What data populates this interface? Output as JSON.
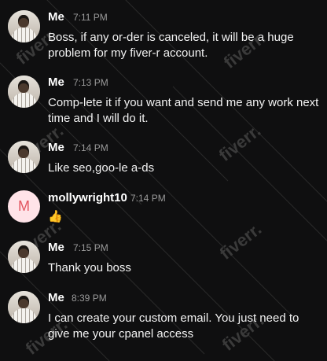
{
  "watermark_text": "fiverr.",
  "messages": [
    {
      "sender": "Me",
      "time": "7:11 PM",
      "avatar_kind": "photo",
      "text": "Boss, if any or-der is canceled, it will be a huge problem for my fiver-r account."
    },
    {
      "sender": "Me",
      "time": "7:13 PM",
      "avatar_kind": "photo",
      "text": "Comp-lete it if you want and send me any work next time and I will do it."
    },
    {
      "sender": "Me",
      "time": "7:14 PM",
      "avatar_kind": "photo",
      "text": "Like seo,goo-le a-ds"
    },
    {
      "sender": "mollywright10",
      "time": "7:14 PM",
      "avatar_kind": "letter",
      "avatar_letter": "M",
      "text": "👍"
    },
    {
      "sender": "Me",
      "time": "7:15 PM",
      "avatar_kind": "photo",
      "text": "Thank you boss"
    },
    {
      "sender": "Me",
      "time": "8:39 PM",
      "avatar_kind": "photo",
      "text": "I can create your custom email. You just need to give me your cpanel access"
    }
  ]
}
